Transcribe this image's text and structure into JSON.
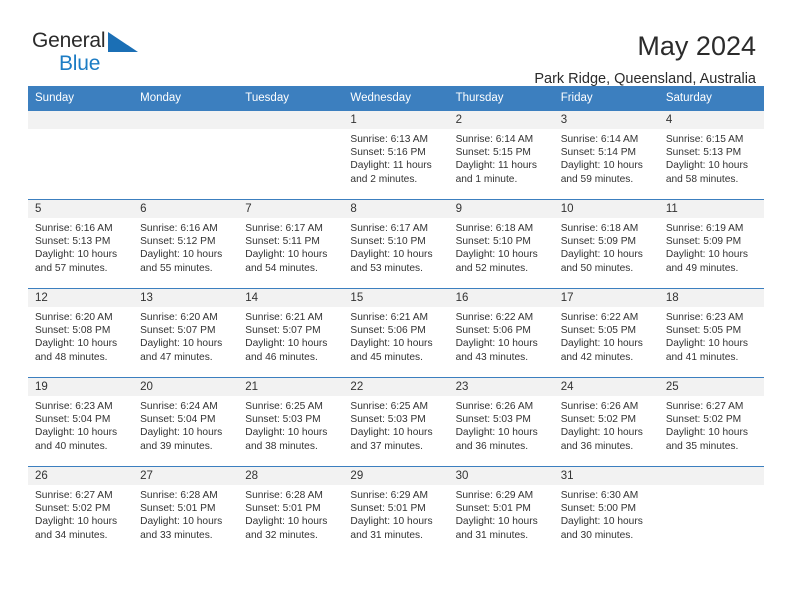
{
  "brand": {
    "name_part1": "General",
    "name_part2": "Blue",
    "accent_color": "#1b6fb5"
  },
  "header": {
    "title": "May 2024",
    "subtitle": "Park Ridge, Queensland, Australia"
  },
  "theme": {
    "header_bg": "#3c7fbf",
    "daynum_bg": "#f2f2f2",
    "text": "#333333"
  },
  "weekday_headers": [
    "Sunday",
    "Monday",
    "Tuesday",
    "Wednesday",
    "Thursday",
    "Friday",
    "Saturday"
  ],
  "weeks": [
    [
      {
        "empty": true
      },
      {
        "empty": true
      },
      {
        "empty": true
      },
      {
        "day": "1",
        "sunrise": "Sunrise: 6:13 AM",
        "sunset": "Sunset: 5:16 PM",
        "daylight1": "Daylight: 11 hours",
        "daylight2": "and 2 minutes."
      },
      {
        "day": "2",
        "sunrise": "Sunrise: 6:14 AM",
        "sunset": "Sunset: 5:15 PM",
        "daylight1": "Daylight: 11 hours",
        "daylight2": "and 1 minute."
      },
      {
        "day": "3",
        "sunrise": "Sunrise: 6:14 AM",
        "sunset": "Sunset: 5:14 PM",
        "daylight1": "Daylight: 10 hours",
        "daylight2": "and 59 minutes."
      },
      {
        "day": "4",
        "sunrise": "Sunrise: 6:15 AM",
        "sunset": "Sunset: 5:13 PM",
        "daylight1": "Daylight: 10 hours",
        "daylight2": "and 58 minutes."
      }
    ],
    [
      {
        "day": "5",
        "sunrise": "Sunrise: 6:16 AM",
        "sunset": "Sunset: 5:13 PM",
        "daylight1": "Daylight: 10 hours",
        "daylight2": "and 57 minutes."
      },
      {
        "day": "6",
        "sunrise": "Sunrise: 6:16 AM",
        "sunset": "Sunset: 5:12 PM",
        "daylight1": "Daylight: 10 hours",
        "daylight2": "and 55 minutes."
      },
      {
        "day": "7",
        "sunrise": "Sunrise: 6:17 AM",
        "sunset": "Sunset: 5:11 PM",
        "daylight1": "Daylight: 10 hours",
        "daylight2": "and 54 minutes."
      },
      {
        "day": "8",
        "sunrise": "Sunrise: 6:17 AM",
        "sunset": "Sunset: 5:10 PM",
        "daylight1": "Daylight: 10 hours",
        "daylight2": "and 53 minutes."
      },
      {
        "day": "9",
        "sunrise": "Sunrise: 6:18 AM",
        "sunset": "Sunset: 5:10 PM",
        "daylight1": "Daylight: 10 hours",
        "daylight2": "and 52 minutes."
      },
      {
        "day": "10",
        "sunrise": "Sunrise: 6:18 AM",
        "sunset": "Sunset: 5:09 PM",
        "daylight1": "Daylight: 10 hours",
        "daylight2": "and 50 minutes."
      },
      {
        "day": "11",
        "sunrise": "Sunrise: 6:19 AM",
        "sunset": "Sunset: 5:09 PM",
        "daylight1": "Daylight: 10 hours",
        "daylight2": "and 49 minutes."
      }
    ],
    [
      {
        "day": "12",
        "sunrise": "Sunrise: 6:20 AM",
        "sunset": "Sunset: 5:08 PM",
        "daylight1": "Daylight: 10 hours",
        "daylight2": "and 48 minutes."
      },
      {
        "day": "13",
        "sunrise": "Sunrise: 6:20 AM",
        "sunset": "Sunset: 5:07 PM",
        "daylight1": "Daylight: 10 hours",
        "daylight2": "and 47 minutes."
      },
      {
        "day": "14",
        "sunrise": "Sunrise: 6:21 AM",
        "sunset": "Sunset: 5:07 PM",
        "daylight1": "Daylight: 10 hours",
        "daylight2": "and 46 minutes."
      },
      {
        "day": "15",
        "sunrise": "Sunrise: 6:21 AM",
        "sunset": "Sunset: 5:06 PM",
        "daylight1": "Daylight: 10 hours",
        "daylight2": "and 45 minutes."
      },
      {
        "day": "16",
        "sunrise": "Sunrise: 6:22 AM",
        "sunset": "Sunset: 5:06 PM",
        "daylight1": "Daylight: 10 hours",
        "daylight2": "and 43 minutes."
      },
      {
        "day": "17",
        "sunrise": "Sunrise: 6:22 AM",
        "sunset": "Sunset: 5:05 PM",
        "daylight1": "Daylight: 10 hours",
        "daylight2": "and 42 minutes."
      },
      {
        "day": "18",
        "sunrise": "Sunrise: 6:23 AM",
        "sunset": "Sunset: 5:05 PM",
        "daylight1": "Daylight: 10 hours",
        "daylight2": "and 41 minutes."
      }
    ],
    [
      {
        "day": "19",
        "sunrise": "Sunrise: 6:23 AM",
        "sunset": "Sunset: 5:04 PM",
        "daylight1": "Daylight: 10 hours",
        "daylight2": "and 40 minutes."
      },
      {
        "day": "20",
        "sunrise": "Sunrise: 6:24 AM",
        "sunset": "Sunset: 5:04 PM",
        "daylight1": "Daylight: 10 hours",
        "daylight2": "and 39 minutes."
      },
      {
        "day": "21",
        "sunrise": "Sunrise: 6:25 AM",
        "sunset": "Sunset: 5:03 PM",
        "daylight1": "Daylight: 10 hours",
        "daylight2": "and 38 minutes."
      },
      {
        "day": "22",
        "sunrise": "Sunrise: 6:25 AM",
        "sunset": "Sunset: 5:03 PM",
        "daylight1": "Daylight: 10 hours",
        "daylight2": "and 37 minutes."
      },
      {
        "day": "23",
        "sunrise": "Sunrise: 6:26 AM",
        "sunset": "Sunset: 5:03 PM",
        "daylight1": "Daylight: 10 hours",
        "daylight2": "and 36 minutes."
      },
      {
        "day": "24",
        "sunrise": "Sunrise: 6:26 AM",
        "sunset": "Sunset: 5:02 PM",
        "daylight1": "Daylight: 10 hours",
        "daylight2": "and 36 minutes."
      },
      {
        "day": "25",
        "sunrise": "Sunrise: 6:27 AM",
        "sunset": "Sunset: 5:02 PM",
        "daylight1": "Daylight: 10 hours",
        "daylight2": "and 35 minutes."
      }
    ],
    [
      {
        "day": "26",
        "sunrise": "Sunrise: 6:27 AM",
        "sunset": "Sunset: 5:02 PM",
        "daylight1": "Daylight: 10 hours",
        "daylight2": "and 34 minutes."
      },
      {
        "day": "27",
        "sunrise": "Sunrise: 6:28 AM",
        "sunset": "Sunset: 5:01 PM",
        "daylight1": "Daylight: 10 hours",
        "daylight2": "and 33 minutes."
      },
      {
        "day": "28",
        "sunrise": "Sunrise: 6:28 AM",
        "sunset": "Sunset: 5:01 PM",
        "daylight1": "Daylight: 10 hours",
        "daylight2": "and 32 minutes."
      },
      {
        "day": "29",
        "sunrise": "Sunrise: 6:29 AM",
        "sunset": "Sunset: 5:01 PM",
        "daylight1": "Daylight: 10 hours",
        "daylight2": "and 31 minutes."
      },
      {
        "day": "30",
        "sunrise": "Sunrise: 6:29 AM",
        "sunset": "Sunset: 5:01 PM",
        "daylight1": "Daylight: 10 hours",
        "daylight2": "and 31 minutes."
      },
      {
        "day": "31",
        "sunrise": "Sunrise: 6:30 AM",
        "sunset": "Sunset: 5:00 PM",
        "daylight1": "Daylight: 10 hours",
        "daylight2": "and 30 minutes."
      },
      {
        "empty": true
      }
    ]
  ]
}
